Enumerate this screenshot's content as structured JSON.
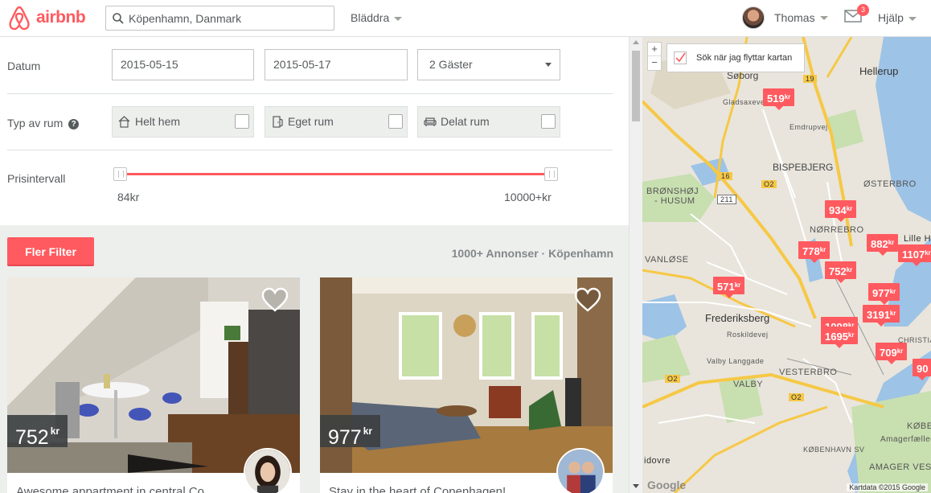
{
  "brand": {
    "name": "airbnb",
    "color": "#ff5a5f"
  },
  "header": {
    "search_value": "Köpenhamn, Danmark",
    "browse_label": "Bläddra",
    "user_name": "Thomas",
    "messages_badge": "3",
    "help_label": "Hjälp"
  },
  "filters": {
    "date_label": "Datum",
    "checkin": "2015-05-15",
    "checkout": "2015-05-17",
    "guests": "2 Gäster",
    "room_type_label": "Typ av rum",
    "room_types": [
      {
        "label": "Helt hem",
        "icon": "house-icon",
        "checked": false
      },
      {
        "label": "Eget rum",
        "icon": "door-icon",
        "checked": false
      },
      {
        "label": "Delat rum",
        "icon": "couch-icon",
        "checked": false
      }
    ],
    "price_label": "Prisintervall",
    "price_min": "84kr",
    "price_max": "10000+kr",
    "more_filters": "Fler Filter",
    "results_count": "1000+ Annonser · Köpenhamn"
  },
  "listings": [
    {
      "price": "752",
      "currency": "kr",
      "title": "Awesome appartment in central Co...",
      "favorite": false
    },
    {
      "price": "977",
      "currency": "kr",
      "title": "Stay in the heart of Copenhagen!",
      "favorite": false
    }
  ],
  "map": {
    "search_on_move_label": "Sök när jag flyttar kartan",
    "search_on_move_checked": true,
    "zoom_in": "+",
    "zoom_out": "−",
    "attribution": "Kartdata ©2015 Google",
    "google_label": "Google",
    "pins": [
      {
        "price": "519",
        "unit": "kr"
      },
      {
        "price": "934",
        "unit": "kr"
      },
      {
        "price": "882",
        "unit": "kr"
      },
      {
        "price": "778",
        "unit": "kr"
      },
      {
        "price": "752",
        "unit": "kr"
      },
      {
        "price": "571",
        "unit": "kr"
      },
      {
        "price": "977",
        "unit": "kr"
      },
      {
        "price": "3191",
        "unit": "kr"
      },
      {
        "price": "1695",
        "unit": "kr"
      },
      {
        "price": "709",
        "unit": "kr"
      },
      {
        "price": "1107",
        "unit": "kr"
      },
      {
        "price": "1098",
        "unit": "kr"
      },
      {
        "price": "90",
        "unit": ""
      }
    ],
    "labels": {
      "soborg": "Søborg",
      "hellerup": "Hellerup",
      "gladsaxevej": "Gladsaxevej",
      "emdrupvej": "Emdrupvej",
      "bispebjerg": "BISPEBJERG",
      "bronshoj": "BRØNSHØJ",
      "husum": "- HUSUM",
      "osterbro": "ØSTERBRO",
      "norrebro": "NØRREBRO",
      "vanlose": "VANLØSE",
      "lille": "Lille Ha",
      "frederiksberg": "Frederiksberg",
      "roskildevej": "Roskildevej",
      "valby_langgade": "Valby Langgade",
      "vesterbro": "VESTERBRO",
      "valby": "VALBY",
      "kobenhavn_sv": "KØBENHAVN SV",
      "amagerfaelled": "Amagerfælled",
      "amager_vest": "AMAGER VEST",
      "hvidovre": "idovre",
      "kobe": "KØBE",
      "christianshavn": "CHRISTIAN",
      "road_19": "19",
      "road_16": "16",
      "road_211": "211",
      "road_o2a": "O2",
      "road_o2b": "O2",
      "road_o2c": "O2"
    }
  }
}
